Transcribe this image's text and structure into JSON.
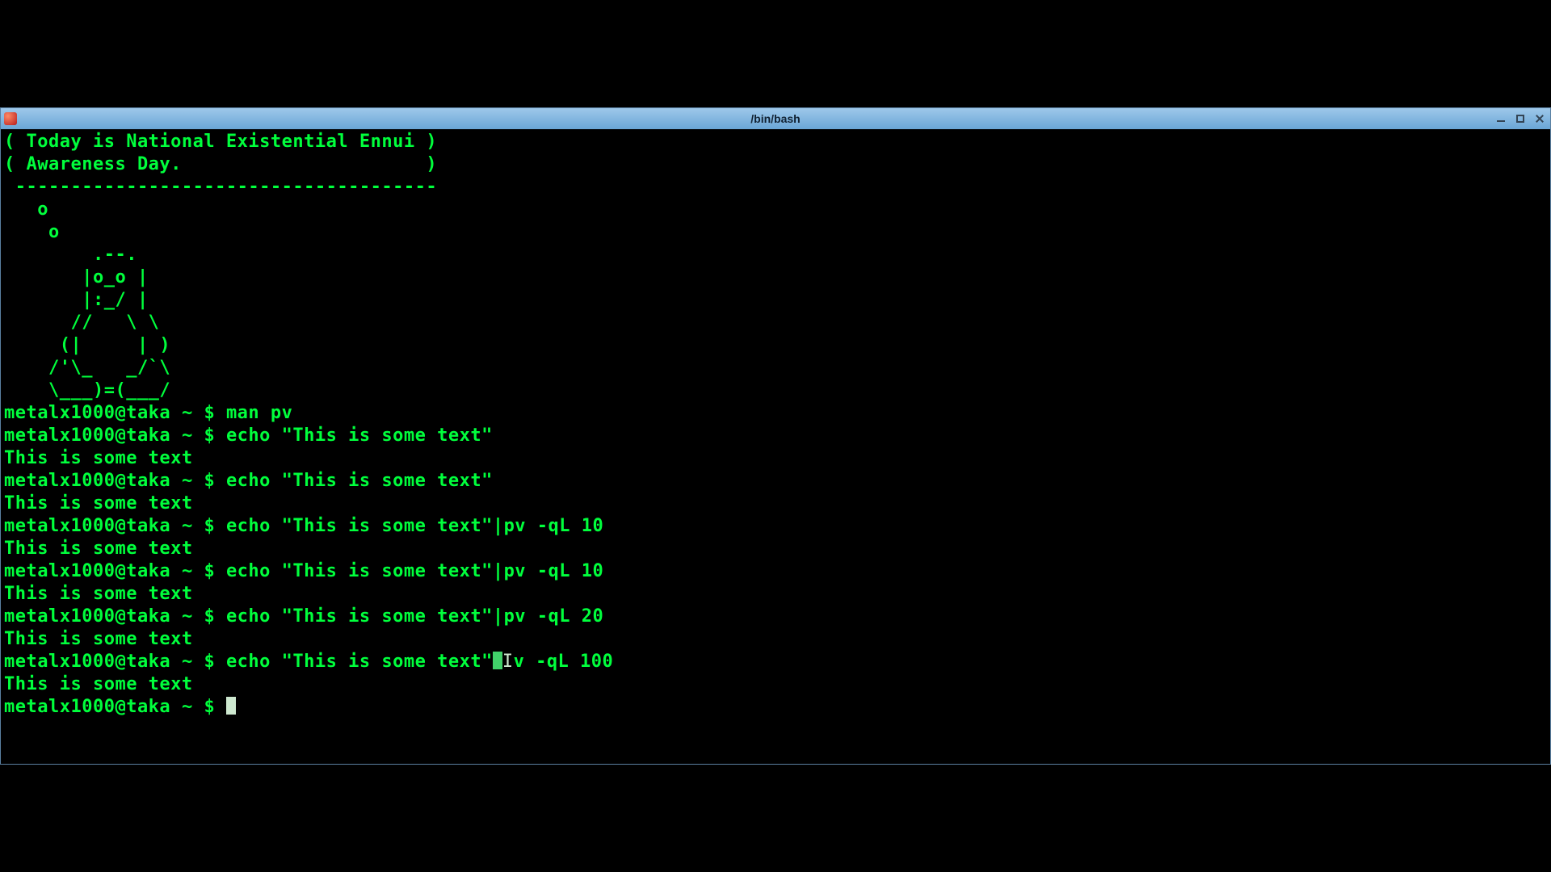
{
  "window": {
    "title": "/bin/bash"
  },
  "motd_lines": [
    "( Today is National Existential Ennui )",
    "( Awareness Day.                      )",
    " --------------------------------------",
    "   o",
    "    o",
    "        .--.",
    "       |o_o |",
    "       |:_/ |",
    "      //   \\ \\",
    "     (|     | )",
    "    /'\\_   _/`\\",
    "    \\___)=(___/"
  ],
  "prompt": {
    "user_host": "metalx1000@taka",
    "path": "~",
    "symbol": "$"
  },
  "history": [
    {
      "cmd": "man pv",
      "output": null
    },
    {
      "cmd": "echo \"This is some text\"",
      "output": "This is some text"
    },
    {
      "cmd": "echo \"This is some text\"",
      "output": "This is some text"
    },
    {
      "cmd": "echo \"This is some text\"|pv -qL 10",
      "output": "This is some text"
    },
    {
      "cmd": "echo \"This is some text\"|pv -qL 10",
      "output": "This is some text"
    },
    {
      "cmd": "echo \"This is some text\"|pv -qL 20",
      "output": "This is some text"
    }
  ],
  "active": {
    "cmd_before_cursor": "echo \"This is some text\"",
    "cmd_after_cursor": "v -qL 100",
    "extra_caret_text": "I",
    "output": "This is some text"
  }
}
